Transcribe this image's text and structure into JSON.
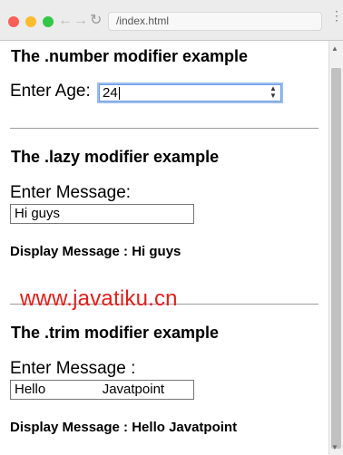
{
  "browser": {
    "url": "/index.html",
    "back_glyph": "←",
    "forward_glyph": "→",
    "reload_glyph": "↻",
    "menu_glyph": "⋮"
  },
  "number_section": {
    "heading": "The .number modifier example",
    "label": "Enter Age:",
    "value": "24"
  },
  "lazy_section": {
    "heading": "The .lazy modifier example",
    "label": "Enter Message:",
    "value": "Hi guys",
    "display": "Display Message : Hi guys"
  },
  "watermark": "www.javatiku.cn",
  "trim_section": {
    "heading": "The .trim modifier example",
    "label": "Enter Message :",
    "value": "Hello               Javatpoint",
    "display": "Display Message : Hello Javatpoint"
  },
  "colors": {
    "focus_ring": "#9cbdf0",
    "watermark": "#e0201b"
  }
}
